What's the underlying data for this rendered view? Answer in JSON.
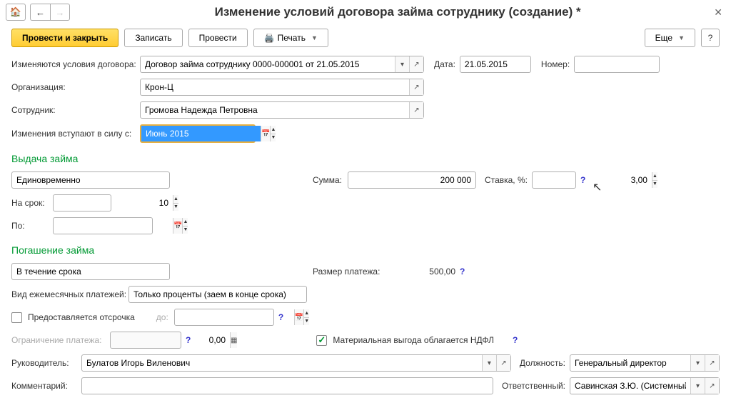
{
  "window": {
    "title": "Изменение условий договора займа сотруднику (создание) *"
  },
  "actions": {
    "post_close": "Провести и закрыть",
    "save": "Записать",
    "post": "Провести",
    "print": "Печать",
    "more": "Еще",
    "help": "?"
  },
  "main": {
    "contract_label": "Изменяются условия договора:",
    "contract_value": "Договор займа сотруднику 0000-000001 от 21.05.2015",
    "date_label": "Дата:",
    "date_value": "21.05.2015",
    "number_label": "Номер:",
    "number_value": "",
    "org_label": "Организация:",
    "org_value": "Крон-Ц",
    "employee_label": "Сотрудник:",
    "employee_value": "Громова Надежда Петровна",
    "effective_label": "Изменения вступают в силу с:",
    "effective_value": "Июнь 2015"
  },
  "issue": {
    "title": "Выдача займа",
    "type_value": "Единовременно",
    "sum_label": "Сумма:",
    "sum_value": "200 000",
    "rate_label": "Ставка, %:",
    "rate_value": "3,00",
    "term_label": "На срок:",
    "term_value": "10",
    "until_label": "По:",
    "until_value": ""
  },
  "repay": {
    "title": "Погашение займа",
    "type_value": "В течение срока",
    "payment_label": "Размер платежа:",
    "payment_value": "500,00",
    "monthly_label": "Вид ежемесячных платежей:",
    "monthly_value": "Только проценты (заем в конце срока)",
    "deferral_label": "Предоставляется отсрочка",
    "deferral_until_label": "до:",
    "deferral_until_value": "",
    "limit_label": "Ограничение платежа:",
    "limit_value": "0,00",
    "ndfl_label": "Материальная выгода облагается НДФЛ"
  },
  "footer": {
    "manager_label": "Руководитель:",
    "manager_value": "Булатов Игорь Виленович",
    "position_label": "Должность:",
    "position_value": "Генеральный директор",
    "comment_label": "Комментарий:",
    "comment_value": "",
    "responsible_label": "Ответственный:",
    "responsible_value": "Савинская З.Ю. (Системный прог"
  }
}
